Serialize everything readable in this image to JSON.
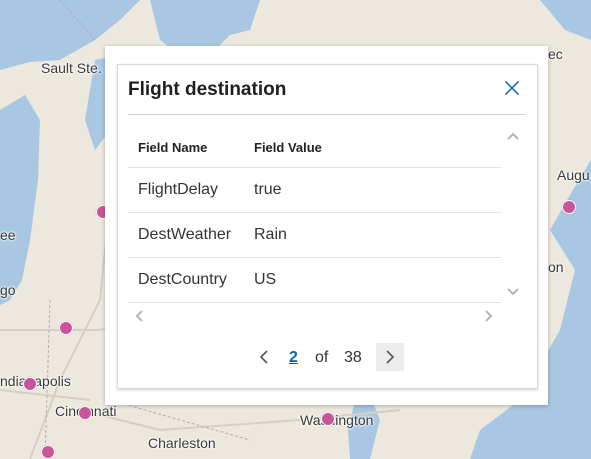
{
  "map": {
    "labels": [
      "Sault Ste.",
      "ec",
      "Augu",
      "ee",
      "go",
      "on",
      "ndianapolis",
      "Cincinnati",
      "Washington",
      "Charleston"
    ],
    "water_color": "#a9c7e2",
    "land_color": "#ece8dd",
    "marker_color": "#c8559b"
  },
  "popup": {
    "title": "Flight destination",
    "close_icon": "close-icon",
    "columns": [
      "Field Name",
      "Field Value"
    ],
    "rows": [
      {
        "name": "FlightDelay",
        "value": "true"
      },
      {
        "name": "DestWeather",
        "value": "Rain"
      },
      {
        "name": "DestCountry",
        "value": "US"
      }
    ],
    "pager": {
      "current": "2",
      "of_label": "of",
      "total": "38"
    }
  }
}
